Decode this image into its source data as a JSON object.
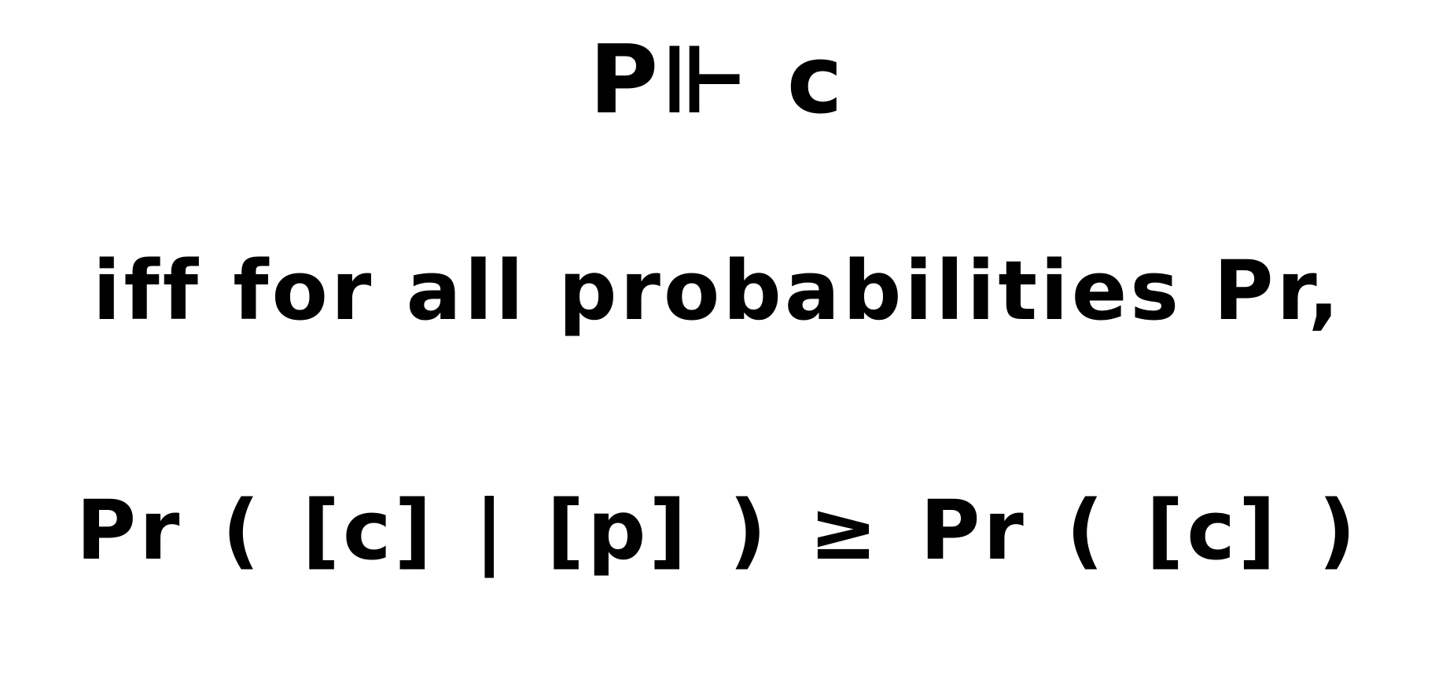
{
  "statement": {
    "lines": [
      "P⊩ c",
      "iff for all probabilities Pr,",
      "Pr ( [c] | [p] ) ≥ Pr ( [c] )"
    ]
  },
  "colors": {
    "ink": "#000000",
    "background": "#ffffff"
  }
}
